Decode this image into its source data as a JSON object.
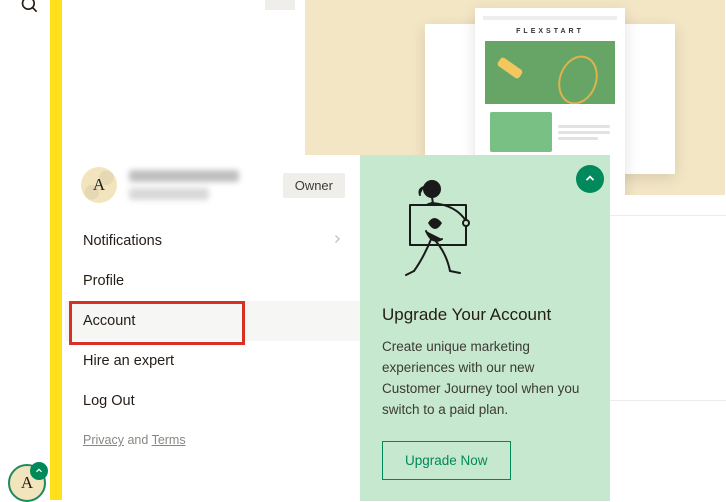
{
  "icons": {
    "search": "search-icon"
  },
  "banner": {
    "template_brand": "FLEXSTART"
  },
  "user": {
    "avatar_letter": "A",
    "owner_badge": "Owner"
  },
  "menu": {
    "notifications": "Notifications",
    "profile": "Profile",
    "account": "Account",
    "hire": "Hire an expert",
    "logout": "Log Out"
  },
  "legal": {
    "privacy": "Privacy",
    "and": " and ",
    "terms": "Terms"
  },
  "upgrade": {
    "title": "Upgrade Your Account",
    "body": "Create unique marketing experiences with our new Customer Journey tool when you switch to a paid plan.",
    "button": "Upgrade Now"
  },
  "float_avatar_letter": "A"
}
